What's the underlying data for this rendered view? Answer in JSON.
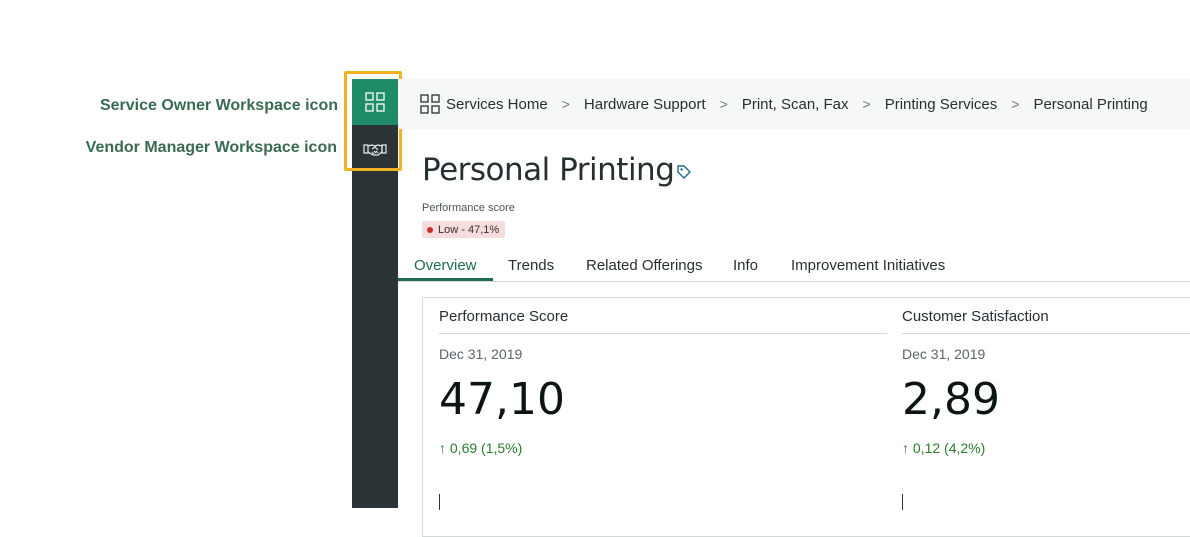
{
  "annotations": {
    "callout_service_owner": "Service Owner Workspace icon",
    "callout_vendor_manager": "Vendor Manager Workspace icon",
    "highlight_color": "#f0b323"
  },
  "sidebar": {
    "items": [
      {
        "icon": "grid-icon",
        "active": true,
        "color": "#1f8c68"
      },
      {
        "icon": "handshake-icon",
        "active": false
      }
    ],
    "background": "#2c3437"
  },
  "breadcrumb": {
    "home": "Services Home",
    "items": [
      "Hardware Support",
      "Print, Scan, Fax",
      "Printing Services",
      "Personal Printing"
    ],
    "separator": ">"
  },
  "page": {
    "title": "Personal Printing",
    "performance_label": "Performance score",
    "performance_badge": "Low - 47,1%",
    "badge_color": "#c92a2a"
  },
  "tabs": {
    "items": [
      "Overview",
      "Trends",
      "Related Offerings",
      "Info",
      "Improvement Initiatives"
    ],
    "active": "Overview",
    "accent": "#1f6a52"
  },
  "metrics": [
    {
      "title": "Performance Score",
      "date": "Dec 31, 2019",
      "value": "47,10",
      "change": "0,69 (1,5%)",
      "trend": "up"
    },
    {
      "title": "Customer Satisfaction",
      "date": "Dec 31, 2019",
      "value": "2,89",
      "change": "0,12 (4,2%)",
      "trend": "up"
    }
  ]
}
